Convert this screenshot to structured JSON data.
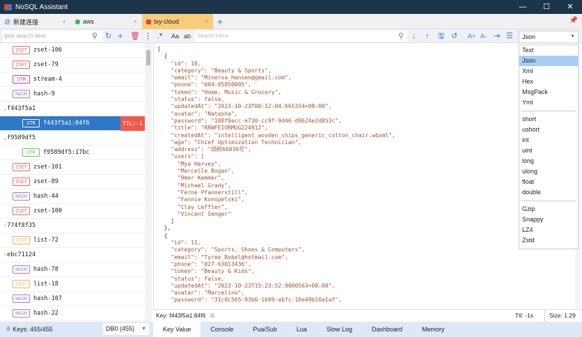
{
  "app": {
    "title": "NoSQL Assistant"
  },
  "tabs": [
    {
      "label": "新建连接",
      "icon": "link-icon"
    },
    {
      "label": "aws",
      "color": "#3bb54a"
    },
    {
      "label": "txy-cloud",
      "color": "#e8452c",
      "active": true
    }
  ],
  "toolbar": {
    "search_placeholder": "glob search here",
    "editor_search_placeholder": "Search Here",
    "format": "Json"
  },
  "keys": [
    {
      "type": "ZSET",
      "name": "zset-106"
    },
    {
      "type": "ZSET",
      "name": "zset-79"
    },
    {
      "type": "STM",
      "name": "stream-4"
    },
    {
      "type": "HASH",
      "name": "hash-9"
    },
    {
      "group": "f443f5a1",
      "expanded": true
    },
    {
      "type": "STR",
      "name": "f443f5a1:84f6",
      "indent": true,
      "selected": true,
      "ttl": "TTL:-1"
    },
    {
      "group": "f9589df5",
      "expanded": true
    },
    {
      "type": "STR",
      "name": "f9589df5:17bc",
      "indent": true
    },
    {
      "type": "ZSET",
      "name": "zset-101"
    },
    {
      "type": "ZSET",
      "name": "zset-89"
    },
    {
      "type": "HASH",
      "name": "hash-44"
    },
    {
      "type": "ZSET",
      "name": "zset-100"
    },
    {
      "group": "774f8f35",
      "expanded": false
    },
    {
      "type": "LIST",
      "name": "list-72"
    },
    {
      "group": "ebc71124",
      "expanded": false
    },
    {
      "type": "HASH",
      "name": "hash-78"
    },
    {
      "type": "LIST",
      "name": "list-18"
    },
    {
      "type": "HASH",
      "name": "hash-107"
    },
    {
      "type": "HASH",
      "name": "hash-22"
    }
  ],
  "type_colors": {
    "ZSET": "#e06a6a",
    "STM": "#c23fa0",
    "HASH": "#a57ac9",
    "STR": "#6abf5a",
    "LIST": "#e9b55a"
  },
  "editor_lines": [
    "[",
    "  {",
    "    \"id\": 10,",
    "    \"category\": \"Beauty & Sports\",",
    "    \"email\": \"Minerva_Hansen@gmail.com\",",
    "    \"phone\": \"004-85850005\",",
    "    \"token\": \"Home, Music & Grocery\",",
    "    \"status\": false,",
    "    \"updatedAt\": \"2023-10-23T00:12:04.665334+08:00\",",
    "    \"avatar\": \"Natasha\",",
    "    \"password\": \"108f9acc-e730-cc9f-9d46-d9624e2d853c\",",
    "    \"title\": \"RRWFEIORMUG224912\",",
    "    \"createdAt\": \"intelligent_wooden_chips_generic_cotton_chair.wbxml\",",
    "    \"age\": \"Chief Optimization Technician\",",
    "    \"address\": \"邱桥66036号\",",
    "    \"users\": [",
    "      \"Mya Harvey\",",
    "      \"Marcelle Bogan\",",
    "      \"Omer Kemmer\",",
    "      \"Michael Grady\",",
    "      \"Ferne Pfannerstill\",",
    "      \"Fannie Konopelski\",",
    "      \"Clay Leffler\",",
    "      \"Vincent Senger\"",
    "    ]",
    "  },",
    "  {",
    "    \"id\": 11,",
    "    \"category\": \"Sports, Shoes & Computers\",",
    "    \"email\": \"Tyree_Robel@hotmail.com\",",
    "    \"phone\": \"027-63013436\",",
    "    \"token\": \"Beauty & Kids\",",
    "    \"status\": false,",
    "    \"updatedAt\": \"2023-10-23T15:23:52.9060563+08:00\",",
    "    \"avatar\": \"Marcelino\",",
    "    \"password\": \"31c0c565-93b6-1609-abfc-16e49b10a1af\","
  ],
  "format_menu": [
    [
      "Text",
      "Json",
      "Xml",
      "Hex",
      "MsgPack",
      "Yml"
    ],
    [
      "short",
      "ushort",
      "int",
      "uint",
      "long",
      "ulong",
      "float",
      "double"
    ],
    [
      "Gzip",
      "Snappy",
      "LZ4",
      "Zstd"
    ]
  ],
  "keybar": {
    "key": "Key: f443f5a1:84f6",
    "ttl": "Ttl: -1s",
    "size": "Size: 1.29 KB"
  },
  "status": {
    "keys": "Keys: 455/455",
    "db": "DB0 (455)",
    "tabs": [
      "Key Value",
      "Console",
      "Pua/Sub",
      "Lua",
      "Slow Log",
      "Dashboard",
      "Memory"
    ],
    "active_tab": "Key Value"
  }
}
